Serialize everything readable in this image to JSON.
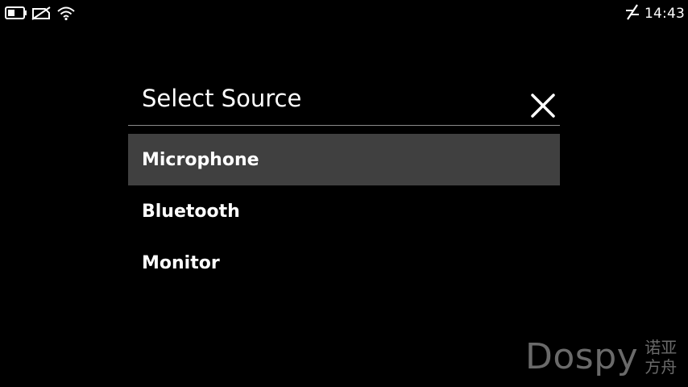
{
  "status_bar": {
    "time": "14:43",
    "left_icons": [
      "battery-icon",
      "no-sim-icon",
      "wifi-icon"
    ],
    "right_icons": [
      "data-transfer-icon"
    ]
  },
  "dialog": {
    "title": "Select Source",
    "close_icon": "close-icon",
    "items": [
      {
        "label": "Microphone",
        "selected": true
      },
      {
        "label": "Bluetooth",
        "selected": false
      },
      {
        "label": "Monitor",
        "selected": false
      }
    ]
  },
  "watermark": {
    "logo": "Dospy",
    "subtitle": "诺亚方舟"
  },
  "colors": {
    "background": "#000000",
    "selected_row": "#404040",
    "divider": "#8a8a8a",
    "text": "#ffffff",
    "watermark": "#6a6a6a"
  }
}
